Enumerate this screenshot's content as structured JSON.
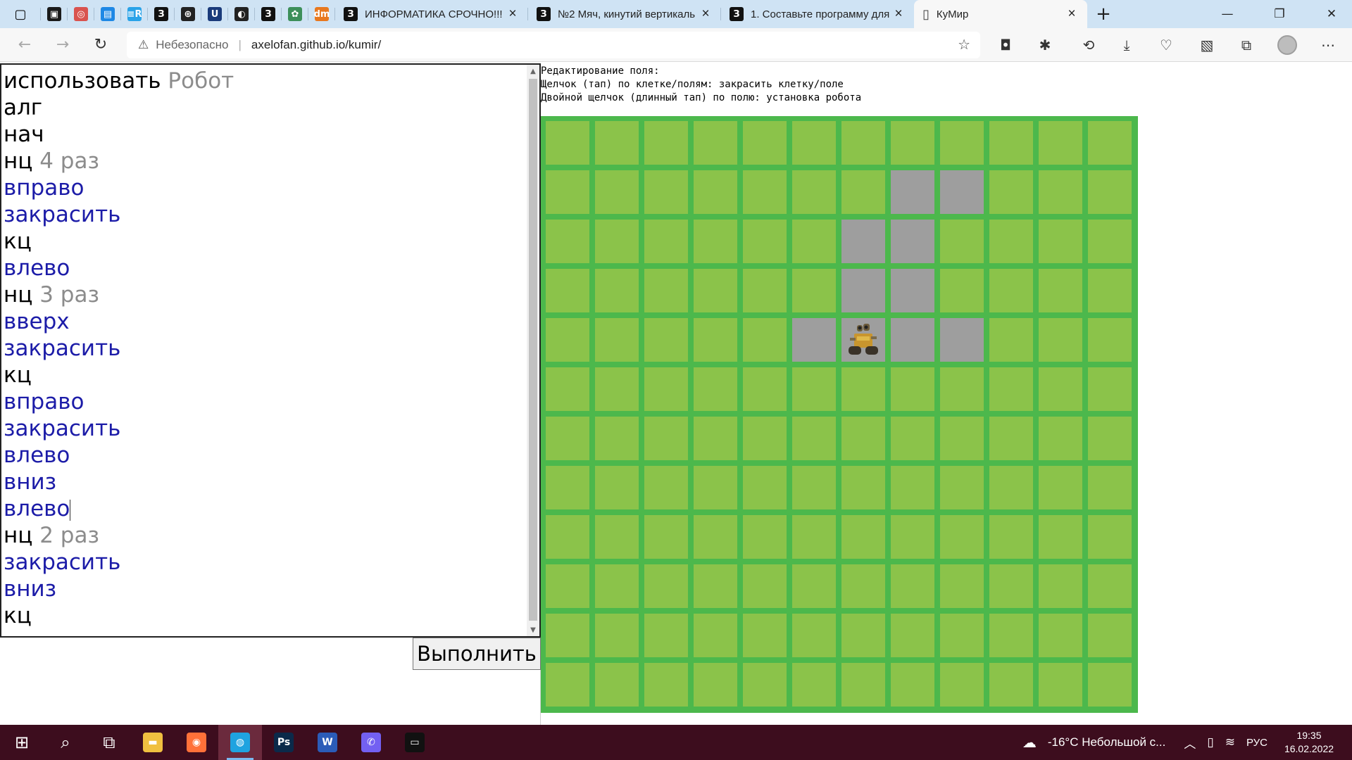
{
  "browser": {
    "pinned_tabs": [
      {
        "name": "pinned-tab-1",
        "glyph": "▣",
        "color": "#1a1a1a"
      },
      {
        "name": "pinned-tab-2",
        "glyph": "◎",
        "color": "#d9534f"
      },
      {
        "name": "pinned-tab-3",
        "glyph": "▤",
        "color": "#1e88e5"
      },
      {
        "name": "pinned-tab-4",
        "glyph": "≡R",
        "color": "#29a3e8"
      },
      {
        "name": "pinned-tab-5",
        "glyph": "З",
        "color": "#111111"
      },
      {
        "name": "pinned-tab-6",
        "glyph": "⊕",
        "color": "#222222"
      },
      {
        "name": "pinned-tab-7",
        "glyph": "U",
        "color": "#1a3a7a"
      },
      {
        "name": "pinned-tab-8",
        "glyph": "◐",
        "color": "#222222"
      },
      {
        "name": "pinned-tab-9",
        "glyph": "З",
        "color": "#111111"
      },
      {
        "name": "pinned-tab-10",
        "glyph": "✿",
        "color": "#3d8f5a"
      },
      {
        "name": "pinned-tab-11",
        "glyph": "dm",
        "color": "#e8781e"
      }
    ],
    "tabs": [
      {
        "title": "ИНФОРМАТИКА СРОЧНО!!!",
        "favicon": "З"
      },
      {
        "title": "№2 Мяч, кинутий вертикаль",
        "favicon": "З"
      },
      {
        "title": "1. Составьте программу для",
        "favicon": "З"
      },
      {
        "title": "КуМир",
        "favicon": "page-icon"
      }
    ],
    "address": {
      "security": "Небезопасно",
      "url": "axelofan.github.io/kumir/"
    }
  },
  "editor": {
    "lines": [
      [
        {
          "t": "использовать",
          "c": "kw"
        },
        {
          "t": " Робот",
          "c": "lit"
        }
      ],
      [
        {
          "t": "алг",
          "c": "kw"
        }
      ],
      [
        {
          "t": "нач",
          "c": "kw"
        }
      ],
      [
        {
          "t": "нц",
          "c": "kw"
        },
        {
          "t": " 4 раз",
          "c": "lit"
        }
      ],
      [
        {
          "t": "вправо",
          "c": "cmd"
        }
      ],
      [
        {
          "t": "закрасить",
          "c": "cmd"
        }
      ],
      [
        {
          "t": "кц",
          "c": "kw"
        }
      ],
      [
        {
          "t": "влево",
          "c": "cmd"
        }
      ],
      [
        {
          "t": "нц",
          "c": "kw"
        },
        {
          "t": " 3 раз",
          "c": "lit"
        }
      ],
      [
        {
          "t": "вверх",
          "c": "cmd"
        }
      ],
      [
        {
          "t": "закрасить",
          "c": "cmd"
        }
      ],
      [
        {
          "t": "кц",
          "c": "kw"
        }
      ],
      [
        {
          "t": "вправо",
          "c": "cmd"
        }
      ],
      [
        {
          "t": "закрасить",
          "c": "cmd"
        }
      ],
      [
        {
          "t": "влево",
          "c": "cmd"
        }
      ],
      [
        {
          "t": "вниз",
          "c": "cmd"
        }
      ],
      [
        {
          "t": "влево",
          "c": "cmd",
          "caret": true
        }
      ],
      [
        {
          "t": "нц",
          "c": "kw"
        },
        {
          "t": " 2 раз",
          "c": "lit"
        }
      ],
      [
        {
          "t": "закрасить",
          "c": "cmd"
        }
      ],
      [
        {
          "t": "вниз",
          "c": "cmd"
        }
      ],
      [
        {
          "t": "кц",
          "c": "kw"
        }
      ]
    ],
    "run_label": "Выполнить"
  },
  "help_text": {
    "line1": "Редактирование поля:",
    "line2": "Щелчок (тап) по клетке/полям: закрасить клетку/поле",
    "line3": "Двойной щелчок (длинный тап) по полю: установка робота"
  },
  "field": {
    "rows": 12,
    "cols": 12,
    "painted": [
      [
        1,
        7
      ],
      [
        1,
        8
      ],
      [
        2,
        6
      ],
      [
        2,
        7
      ],
      [
        3,
        6
      ],
      [
        3,
        7
      ],
      [
        4,
        5
      ],
      [
        4,
        6
      ],
      [
        4,
        7
      ],
      [
        4,
        8
      ]
    ],
    "robot": [
      4,
      6
    ],
    "colors": {
      "wall": "#4cb84c",
      "cell": "#8bc34a",
      "painted": "#9e9e9e"
    }
  },
  "taskbar": {
    "apps": [
      {
        "name": "start-button",
        "glyph": "⊞"
      },
      {
        "name": "search-icon",
        "glyph": "⌕"
      },
      {
        "name": "task-view-icon",
        "glyph": "⧉"
      },
      {
        "name": "file-explorer-icon",
        "glyph": "▬",
        "color": "#f0c040"
      },
      {
        "name": "firefox-icon",
        "glyph": "◉",
        "color": "#ff7139"
      },
      {
        "name": "edge-icon",
        "glyph": "◍",
        "color": "#1fa3e0",
        "active": true
      },
      {
        "name": "photoshop-icon",
        "glyph": "Ps",
        "color": "#0b2a4a"
      },
      {
        "name": "word-icon",
        "glyph": "W",
        "color": "#2b5cb8"
      },
      {
        "name": "viber-icon",
        "glyph": "✆",
        "color": "#7360f2"
      },
      {
        "name": "terminal-icon",
        "glyph": "▭",
        "color": "#111111"
      }
    ],
    "weather": "-16°C  Небольшой с...",
    "lang": "РУС",
    "time": "19:35",
    "date": "16.02.2022"
  }
}
